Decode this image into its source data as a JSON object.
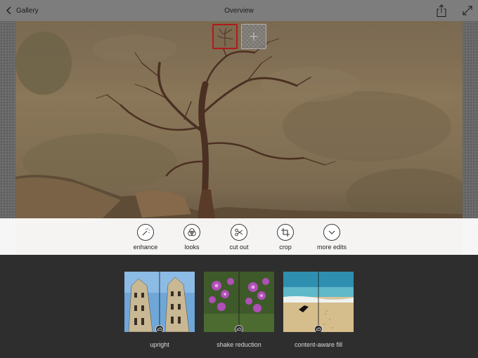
{
  "header": {
    "back_label": "Gallery",
    "title": "Overview"
  },
  "tools": [
    {
      "label": "enhance",
      "icon": "magic-wand-icon"
    },
    {
      "label": "looks",
      "icon": "overlapping-circles-icon"
    },
    {
      "label": "cut out",
      "icon": "scissors-icon"
    },
    {
      "label": "crop",
      "icon": "crop-icon"
    },
    {
      "label": "more edits",
      "icon": "chevron-down-icon"
    }
  ],
  "features": [
    {
      "label": "upright",
      "icon": "creative-cloud-icon"
    },
    {
      "label": "shake reduction",
      "icon": "creative-cloud-icon"
    },
    {
      "label": "content-aware fill",
      "icon": "creative-cloud-icon"
    }
  ],
  "colors": {
    "selected_thumb_border": "#b01b1b",
    "toolbar_bg": "#ffffff",
    "bottom_panel_bg": "#2e2e2e"
  }
}
